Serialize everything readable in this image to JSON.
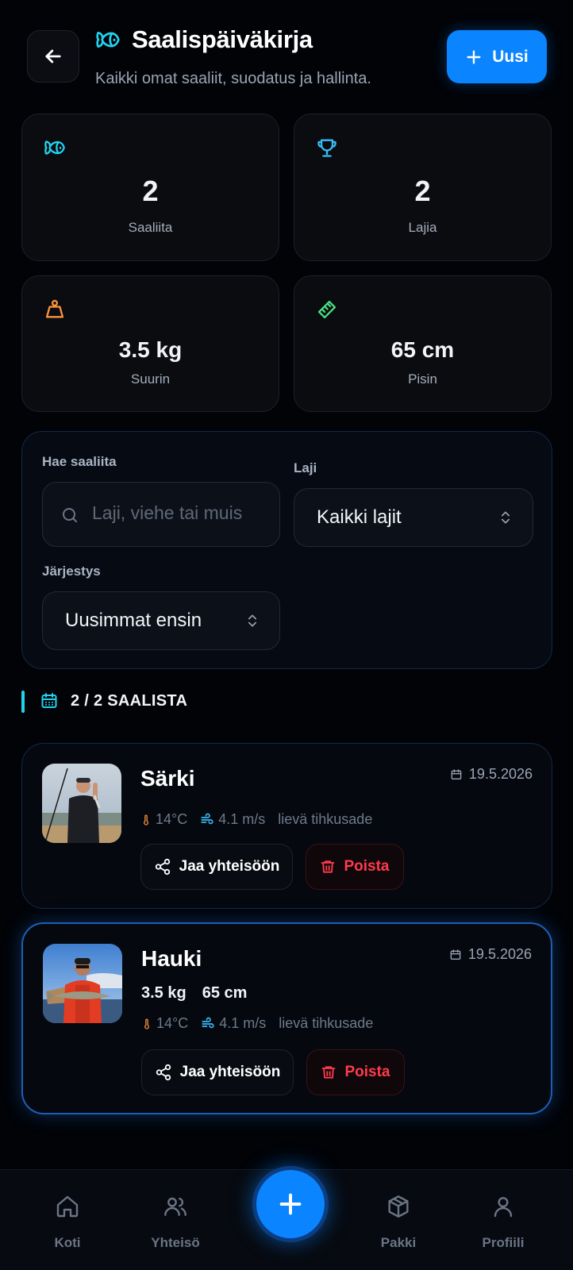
{
  "header": {
    "title": "Saalispäiväkirja",
    "subtitle": "Kaikki omat saaliit, suodatus ja hallinta.",
    "new_button": "Uusi"
  },
  "stats": [
    {
      "icon": "fish-icon",
      "value": "2",
      "label": "Saaliita",
      "color": "#22d3ee"
    },
    {
      "icon": "trophy-icon",
      "value": "2",
      "label": "Lajia",
      "color": "#38bdf8"
    },
    {
      "icon": "weight-icon",
      "value": "3.5 kg",
      "label": "Suurin",
      "color": "#fb923c"
    },
    {
      "icon": "ruler-icon",
      "value": "65 cm",
      "label": "Pisin",
      "color": "#4ade80"
    }
  ],
  "filters": {
    "search_label": "Hae saaliita",
    "search_placeholder": "Laji, viehe tai muis",
    "species_label": "Laji",
    "species_value": "Kaikki lajit",
    "order_label": "Järjestys",
    "order_value": "Uusimmat ensin"
  },
  "section": {
    "title": "2 / 2 SAALISTA"
  },
  "catches": [
    {
      "species": "Särki",
      "date": "19.5.2026",
      "weight": "",
      "length": "",
      "temperature": "14°C",
      "wind": "4.1 m/s",
      "conditions": "lievä tihkusade",
      "share_label": "Jaa yhteisöön",
      "delete_label": "Poista"
    },
    {
      "species": "Hauki",
      "date": "19.5.2026",
      "weight": "3.5 kg",
      "length": "65 cm",
      "temperature": "14°C",
      "wind": "4.1 m/s",
      "conditions": "lievä tihkusade",
      "share_label": "Jaa yhteisöön",
      "delete_label": "Poista"
    }
  ],
  "nav": {
    "items": [
      {
        "label": "Koti",
        "icon": "home-icon"
      },
      {
        "label": "Yhteisö",
        "icon": "community-icon"
      },
      {
        "label": "Pakki",
        "icon": "box-icon"
      },
      {
        "label": "Profiili",
        "icon": "profile-icon"
      }
    ],
    "fab_icon": "plus-icon"
  },
  "colors": {
    "accent": "#0a84ff",
    "cyan": "#22d3ee",
    "danger": "#ff3b4e",
    "background": "#010307"
  }
}
